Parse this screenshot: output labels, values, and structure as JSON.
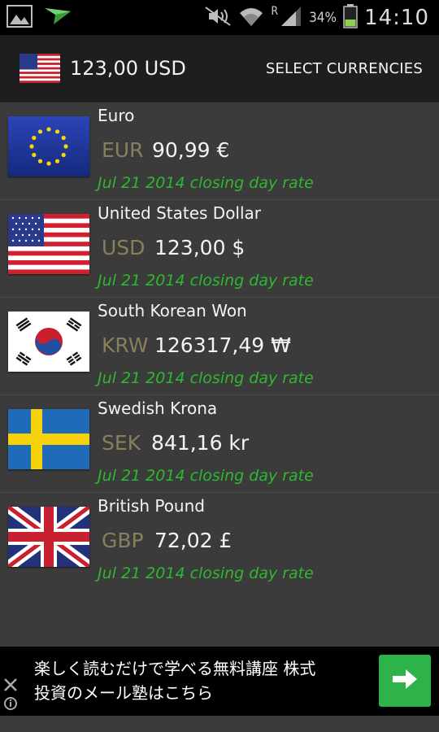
{
  "status_bar": {
    "icons_left": [
      "gallery-icon",
      "send-icon"
    ],
    "icons_right": [
      "mute-icon",
      "wifi-icon",
      "signal-icon",
      "battery-icon"
    ],
    "roaming": "R",
    "battery": "34%",
    "time": "14:10"
  },
  "header": {
    "amount": "123,00 USD",
    "select_label": "SELECT CURRENCIES"
  },
  "currencies": [
    {
      "name": "Euro",
      "code": "EUR",
      "value": "90,99 €",
      "rate_text": "Jul 21 2014 closing day rate"
    },
    {
      "name": "United States Dollar",
      "code": "USD",
      "value": "123,00 $",
      "rate_text": "Jul 21 2014 closing day rate"
    },
    {
      "name": "South Korean Won",
      "code": "KRW",
      "value": "126317,49 ₩",
      "rate_text": "Jul 21 2014 closing day rate"
    },
    {
      "name": "Swedish Krona",
      "code": "SEK",
      "value": "841,16 kr",
      "rate_text": "Jul 21 2014 closing day rate"
    },
    {
      "name": "British Pound",
      "code": "GBP",
      "value": "72,02 £",
      "rate_text": "Jul 21 2014 closing day rate"
    }
  ],
  "ad": {
    "line1": "楽しく読むだけで学べる無料講座 株式",
    "line2": "投資のメール塾はこちら"
  },
  "colors": {
    "rate_green": "#2eb82e",
    "code_tan": "#8a7f5c",
    "background": "#3b3b3b",
    "header_bg": "#1e1e1e",
    "ad_button": "#2db34a"
  }
}
